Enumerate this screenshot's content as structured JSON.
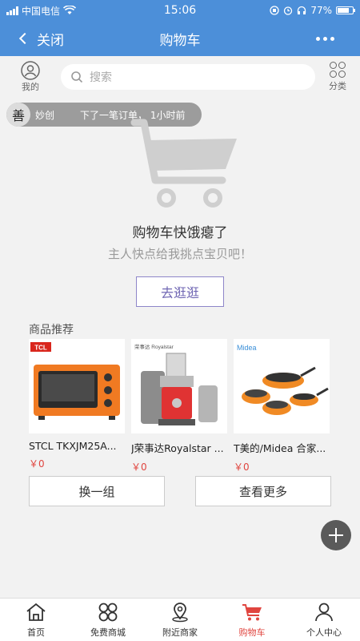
{
  "status_bar": {
    "carrier": "中国电信",
    "time": "15:06",
    "battery": "77%"
  },
  "navbar": {
    "back_label": "关闭",
    "title": "购物车"
  },
  "search": {
    "placeholder": "搜索",
    "mine_label": "我的",
    "category_label": "分类"
  },
  "toast": {
    "avatar_char": "善",
    "nickname": "妙创",
    "message": "下了一笔订单， 1小时前"
  },
  "empty": {
    "title": "购物车快饿瘪了",
    "subtitle": "主人快点给我挑点宝贝吧！",
    "button": "去逛逛"
  },
  "recommend": {
    "title": "商品推荐",
    "products": [
      {
        "name": "STCL TKXJM25A...",
        "price": "￥0",
        "brand": "TCL"
      },
      {
        "name": "J荣事达Royalstar ...",
        "price": "￥0",
        "brand": "荣事达 Royalstar"
      },
      {
        "name": "T美的/Midea 合家...",
        "price": "￥0",
        "brand": "Midea"
      }
    ],
    "refresh_button": "换一组",
    "more_button": "查看更多"
  },
  "tabs": [
    {
      "label": "首页",
      "icon": "home-icon"
    },
    {
      "label": "免费商城",
      "icon": "grid-icon"
    },
    {
      "label": "附近商家",
      "icon": "location-icon"
    },
    {
      "label": "购物车",
      "icon": "cart-icon",
      "active": true
    },
    {
      "label": "个人中心",
      "icon": "person-icon"
    }
  ],
  "colors": {
    "primary": "#4c8fd9",
    "accent": "#e0453f",
    "button_border": "#8e86c9"
  }
}
